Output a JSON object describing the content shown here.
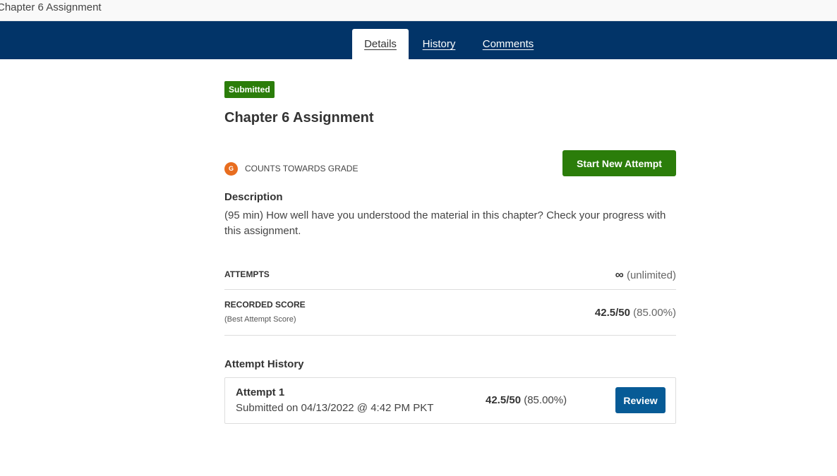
{
  "window": {
    "title": "Chapter 6 Assignment"
  },
  "tabs": [
    {
      "label": "Details",
      "active": true
    },
    {
      "label": "History",
      "active": false
    },
    {
      "label": "Comments",
      "active": false
    }
  ],
  "assignment": {
    "status_badge": "Submitted",
    "title": "Chapter 6 Assignment",
    "grade_icon_letter": "G",
    "grade_label": "COUNTS TOWARDS GRADE",
    "start_button": "Start New Attempt",
    "description_heading": "Description",
    "description_text": "(95 min) How well have you understood the material in this chapter? Check your progress with this assignment."
  },
  "attempts": {
    "label": "ATTEMPTS",
    "icon": "infinity-icon",
    "icon_glyph": "∞",
    "value": "(unlimited)"
  },
  "recorded_score": {
    "label": "RECORDED SCORE",
    "sublabel": "(Best Attempt Score)",
    "score": "42.5/50",
    "percent": "(85.00%)"
  },
  "attempt_history": {
    "heading": "Attempt History",
    "items": [
      {
        "title": "Attempt 1",
        "submitted": "Submitted on 04/13/2022 @ 4:42 PM PKT",
        "score": "42.5/50",
        "percent": "(85.00%)",
        "button": "Review"
      }
    ]
  },
  "colors": {
    "navbar": "#023468",
    "submitted_badge": "#2b7d0a",
    "start_button": "#2b7d0a",
    "grade_icon": "#e86d1f",
    "review_button": "#075b96"
  }
}
